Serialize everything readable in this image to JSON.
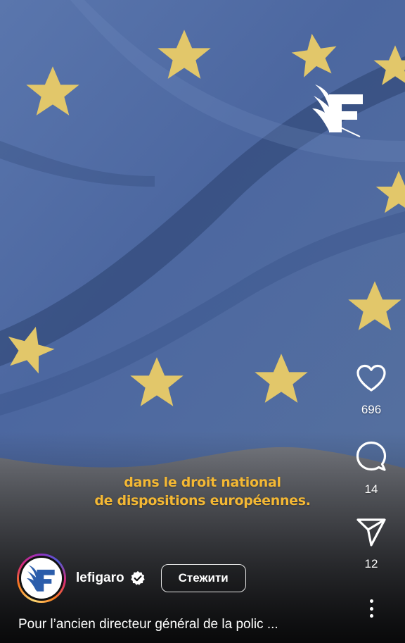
{
  "video": {
    "subtitle_line1": "dans le droit national",
    "subtitle_line2": "de dispositions européennes.",
    "brand_logo_icon": "le-figaro-logo-icon",
    "colors": {
      "flag_blue": "#4f6aa0",
      "star_yellow": "#e2c76a",
      "subtitle_yellow": "#f4b834"
    }
  },
  "actions": {
    "like_icon": "heart-icon",
    "like_count": "696",
    "comment_icon": "comment-icon",
    "comment_count": "14",
    "share_icon": "send-icon",
    "share_count": "12",
    "more_icon": "more-vertical-icon"
  },
  "account": {
    "username": "lefigaro",
    "verified_icon": "verified-badge-icon",
    "follow_label": "Стежити"
  },
  "caption": {
    "text": "Pour l’ancien directeur général de la polic ..."
  }
}
